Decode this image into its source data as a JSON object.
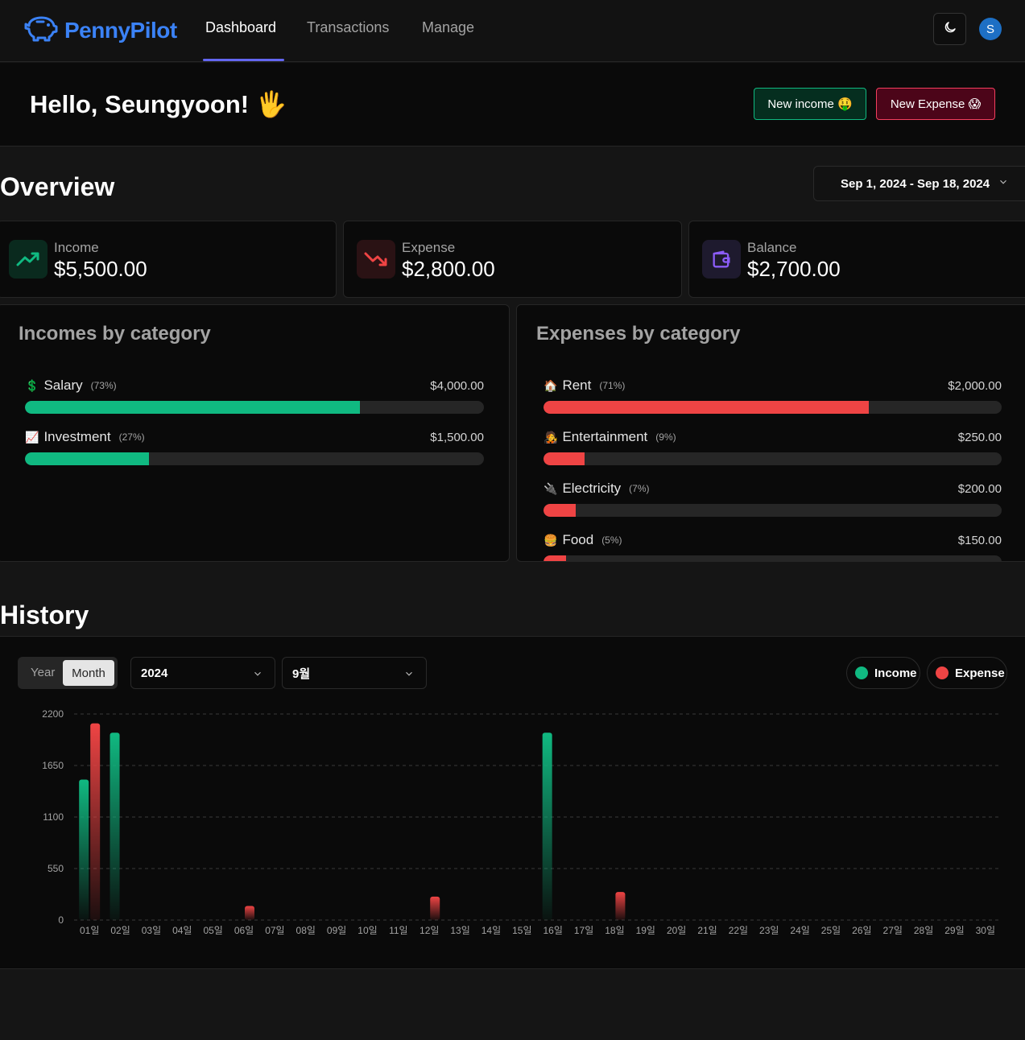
{
  "nav": {
    "brand": "PennyPilot",
    "links": [
      {
        "label": "Dashboard",
        "active": true
      },
      {
        "label": "Transactions",
        "active": false
      },
      {
        "label": "Manage",
        "active": false
      }
    ],
    "theme_icon": "moon-icon",
    "avatar_initial": "S",
    "brand_color": "#3b82f6",
    "accent_color": "#6366f1"
  },
  "greeting": {
    "text": "Hello, Seungyoon! 🖐",
    "new_income_label": "New income 🤑",
    "new_expense_label": "New Expense 😱"
  },
  "overview": {
    "title": "Overview",
    "date_range": "Sep 1, 2024 - Sep 18, 2024",
    "stats": [
      {
        "label": "Income",
        "value": "$5,500.00",
        "icon": "trending-up-icon",
        "color": "#10b981"
      },
      {
        "label": "Expense",
        "value": "$2,800.00",
        "icon": "trending-down-icon",
        "color": "#ef4444"
      },
      {
        "label": "Balance",
        "value": "$2,700.00",
        "icon": "wallet-icon",
        "color": "#8b5cf6"
      }
    ]
  },
  "incomes_by_category": {
    "title": "Incomes by category",
    "items": [
      {
        "emoji": "💲",
        "name": "Salary",
        "pct": "(73%)",
        "amount": "$4,000.00",
        "fraction": 0.73
      },
      {
        "emoji": "📈",
        "name": "Investment",
        "pct": "(27%)",
        "amount": "$1,500.00",
        "fraction": 0.27
      }
    ]
  },
  "expenses_by_category": {
    "title": "Expenses by category",
    "items": [
      {
        "emoji": "🏠",
        "name": "Rent",
        "pct": "(71%)",
        "amount": "$2,000.00",
        "fraction": 0.71
      },
      {
        "emoji": "🧑‍🎤",
        "name": "Entertainment",
        "pct": "(9%)",
        "amount": "$250.00",
        "fraction": 0.09
      },
      {
        "emoji": "🔌",
        "name": "Electricity",
        "pct": "(7%)",
        "amount": "$200.00",
        "fraction": 0.07
      },
      {
        "emoji": "🍔",
        "name": "Food",
        "pct": "(5%)",
        "amount": "$150.00",
        "fraction": 0.05
      }
    ]
  },
  "history": {
    "title": "History",
    "period_toggle": {
      "year_label": "Year",
      "month_label": "Month",
      "selected": "Month"
    },
    "year_select": "2024",
    "month_select": "9월",
    "legend": {
      "income_label": "Income",
      "expense_label": "Expense"
    }
  },
  "chart_data": {
    "type": "bar",
    "categories": [
      "01일",
      "02일",
      "03일",
      "04일",
      "05일",
      "06일",
      "07일",
      "08일",
      "09일",
      "10일",
      "11일",
      "12일",
      "13일",
      "14일",
      "15일",
      "16일",
      "17일",
      "18일",
      "19일",
      "20일",
      "21일",
      "22일",
      "23일",
      "24일",
      "25일",
      "26일",
      "27일",
      "28일",
      "29일",
      "30일"
    ],
    "series": [
      {
        "name": "Income",
        "color": "#10b981",
        "values": [
          1500,
          2000,
          0,
          0,
          0,
          0,
          0,
          0,
          0,
          0,
          0,
          0,
          0,
          0,
          0,
          2000,
          0,
          0,
          0,
          0,
          0,
          0,
          0,
          0,
          0,
          0,
          0,
          0,
          0,
          0
        ]
      },
      {
        "name": "Expense",
        "color": "#ef4444",
        "values": [
          2100,
          0,
          0,
          0,
          0,
          150,
          0,
          0,
          0,
          0,
          0,
          250,
          0,
          0,
          0,
          0,
          0,
          300,
          0,
          0,
          0,
          0,
          0,
          0,
          0,
          0,
          0,
          0,
          0,
          0
        ]
      }
    ],
    "yticks": [
      0,
      550,
      1100,
      1650,
      2200
    ],
    "ylim": [
      0,
      2200
    ],
    "grid": true
  }
}
